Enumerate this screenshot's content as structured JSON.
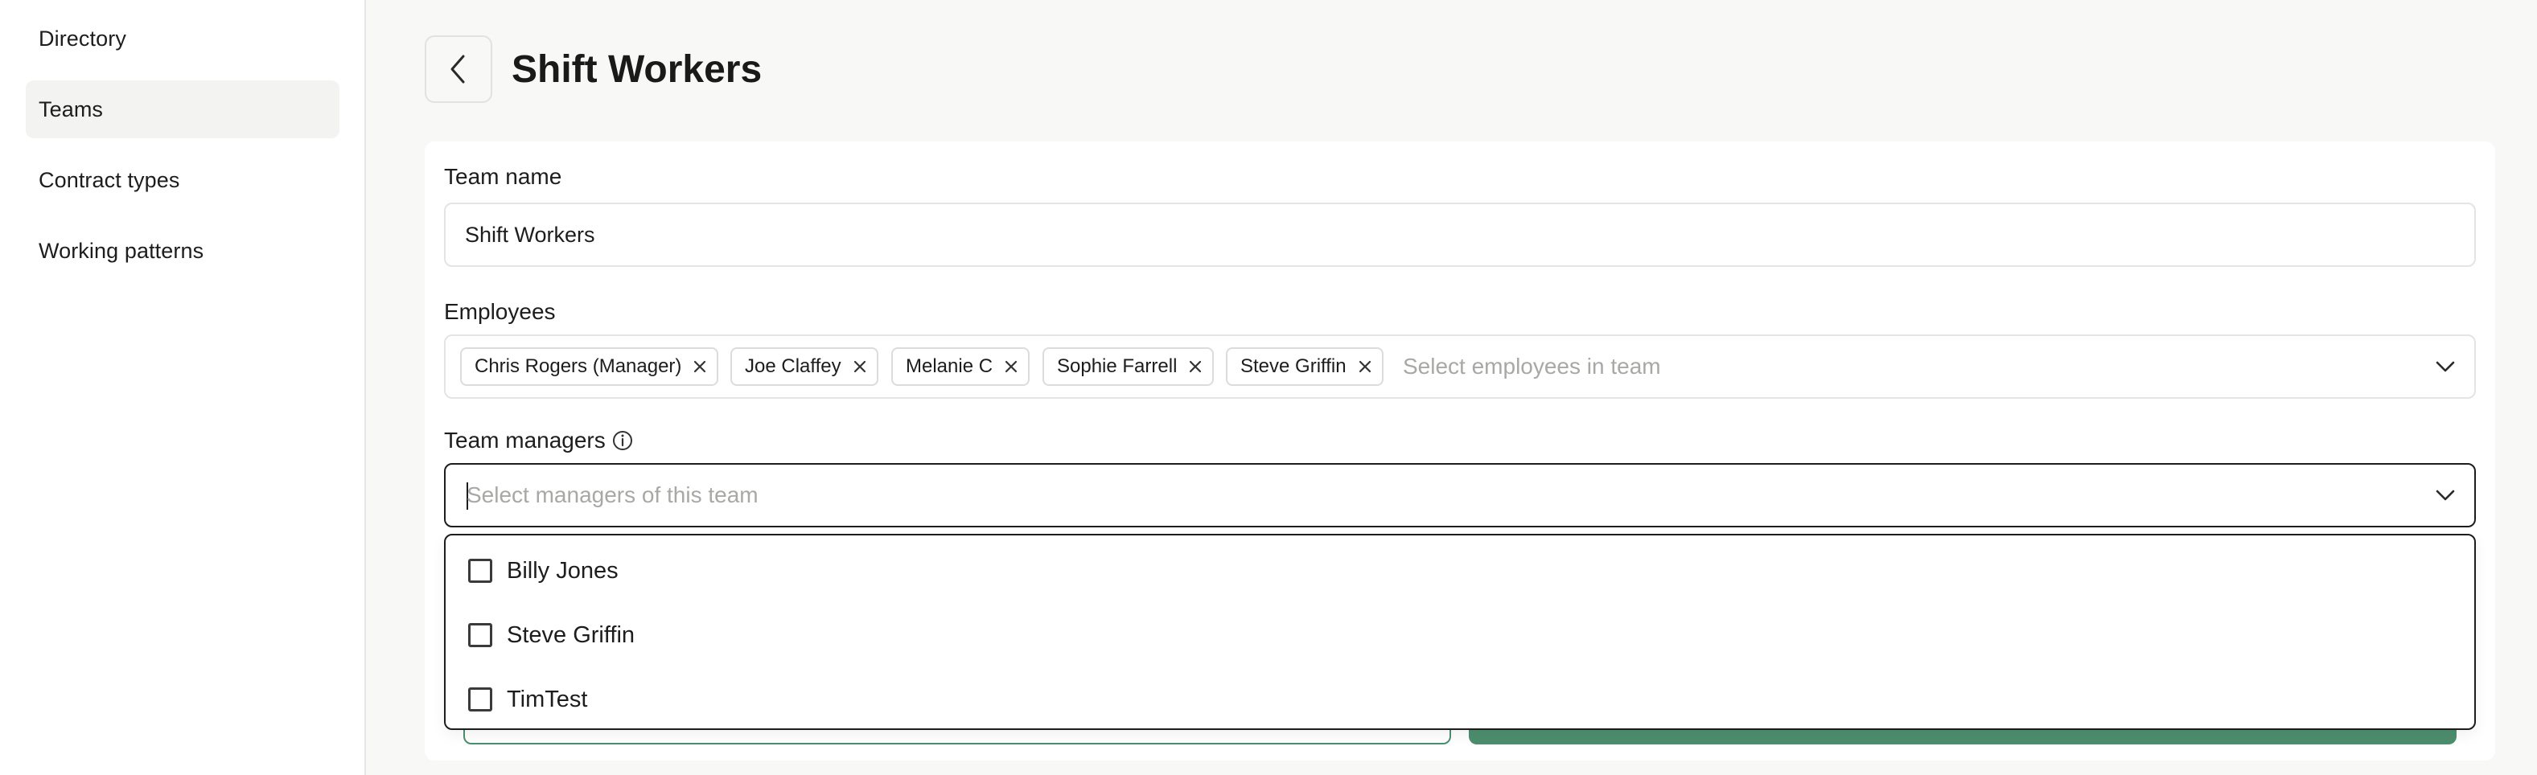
{
  "sidebar": {
    "items": [
      {
        "label": "Directory",
        "active": false
      },
      {
        "label": "Teams",
        "active": true
      },
      {
        "label": "Contract types",
        "active": false
      },
      {
        "label": "Working patterns",
        "active": false
      }
    ]
  },
  "header": {
    "back_icon": "chevron-left-icon",
    "title": "Shift Workers"
  },
  "form": {
    "team_name": {
      "label": "Team name",
      "value": "Shift Workers"
    },
    "employees": {
      "label": "Employees",
      "chips": [
        "Chris Rogers (Manager)",
        "Joe Claffey",
        "Melanie C",
        "Sophie Farrell",
        "Steve Griffin"
      ],
      "placeholder": "Select employees in team"
    },
    "team_managers": {
      "label": "Team managers",
      "info_icon": "info-icon",
      "placeholder": "Select managers of this team",
      "options": [
        {
          "label": "Billy Jones",
          "checked": false
        },
        {
          "label": "Steve Griffin",
          "checked": false
        },
        {
          "label": "TimTest",
          "checked": false
        }
      ]
    }
  },
  "colors": {
    "accent": "#4d8e6e",
    "background": "#f8f8f7",
    "border": "#e4e4e2",
    "placeholder": "#a8a8a6"
  }
}
